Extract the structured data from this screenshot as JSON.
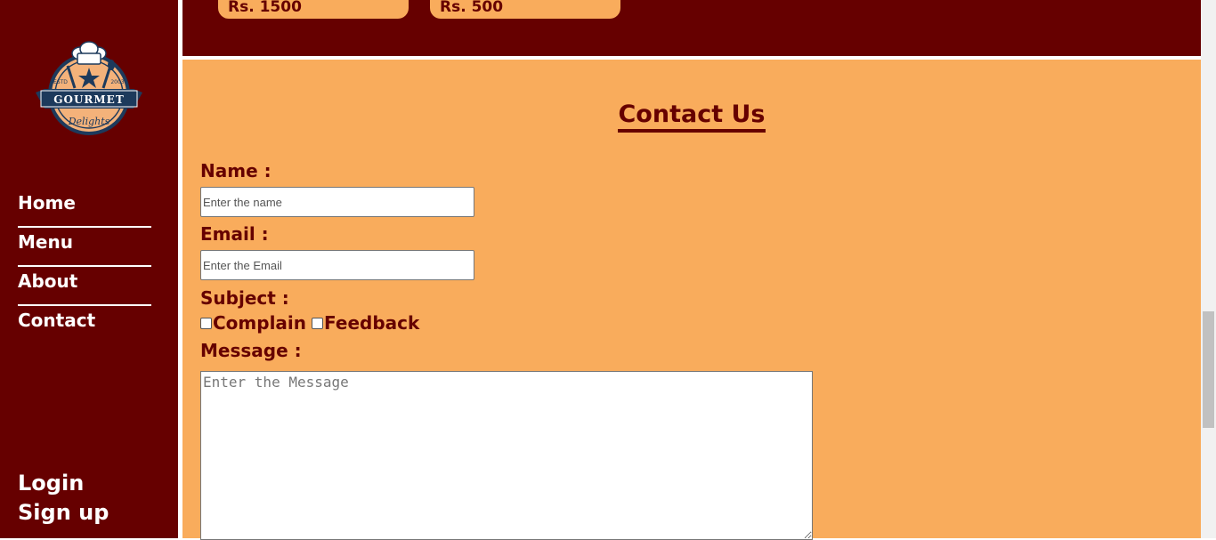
{
  "brand": {
    "logo_top_text": "GOURMET",
    "logo_script_text": "Delights",
    "logo_left_text": "ESTD",
    "logo_right_text": "2003"
  },
  "sidebar": {
    "nav": [
      {
        "label": "Home"
      },
      {
        "label": "Menu"
      },
      {
        "label": "About"
      },
      {
        "label": "Contact"
      }
    ],
    "auth": [
      {
        "label": "Login"
      },
      {
        "label": "Sign up"
      }
    ]
  },
  "menu_cards": [
    {
      "price": "Rs. 1500"
    },
    {
      "price": "Rs. 500"
    }
  ],
  "contact": {
    "title": "Contact Us",
    "name_label": "Name :",
    "name_placeholder": "Enter the name",
    "email_label": "Email :",
    "email_placeholder": "Enter the Email",
    "subject_label": "Subject :",
    "subject_options": [
      {
        "label": "Complain"
      },
      {
        "label": "Feedback"
      }
    ],
    "message_label": "Message :",
    "message_placeholder": "Enter the Message"
  },
  "colors": {
    "primary": "#660000",
    "accent": "#f9ac5c",
    "text_light": "#ffffff"
  }
}
